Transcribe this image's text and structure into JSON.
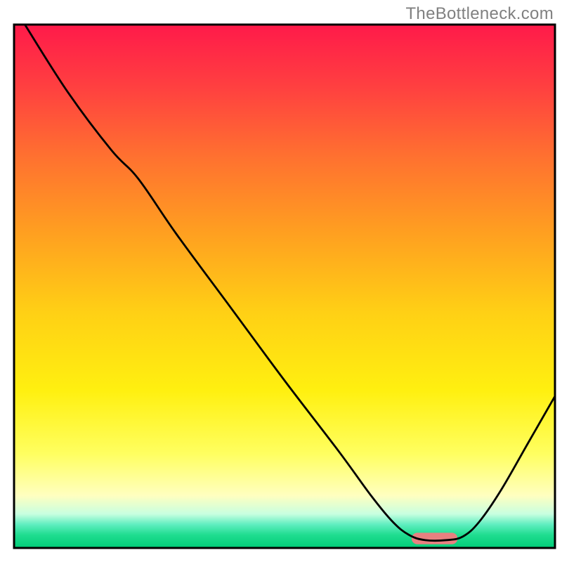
{
  "watermark": "TheBottleneck.com",
  "chart_data": {
    "type": "line",
    "title": "",
    "xlabel": "",
    "ylabel": "",
    "xlim": [
      0,
      100
    ],
    "ylim": [
      0,
      100
    ],
    "background": {
      "type": "vertical-gradient",
      "stops": [
        {
          "offset": 0.0,
          "color": "#ff1a4a"
        },
        {
          "offset": 0.12,
          "color": "#ff4040"
        },
        {
          "offset": 0.25,
          "color": "#ff7030"
        },
        {
          "offset": 0.4,
          "color": "#ffa020"
        },
        {
          "offset": 0.55,
          "color": "#ffd015"
        },
        {
          "offset": 0.7,
          "color": "#fff010"
        },
        {
          "offset": 0.82,
          "color": "#ffff60"
        },
        {
          "offset": 0.9,
          "color": "#ffffc0"
        },
        {
          "offset": 0.935,
          "color": "#c8ffe0"
        },
        {
          "offset": 0.955,
          "color": "#60eec0"
        },
        {
          "offset": 0.975,
          "color": "#20dd90"
        },
        {
          "offset": 1.0,
          "color": "#00cc77"
        }
      ]
    },
    "series": [
      {
        "name": "bottleneck-curve",
        "color": "#000000",
        "width": 2.8,
        "points": [
          {
            "x": 2.0,
            "y": 100.0
          },
          {
            "x": 10.0,
            "y": 87.0
          },
          {
            "x": 18.0,
            "y": 76.0
          },
          {
            "x": 23.0,
            "y": 70.5
          },
          {
            "x": 30.0,
            "y": 60.0
          },
          {
            "x": 40.0,
            "y": 46.0
          },
          {
            "x": 50.0,
            "y": 32.0
          },
          {
            "x": 60.0,
            "y": 18.5
          },
          {
            "x": 66.0,
            "y": 10.0
          },
          {
            "x": 70.0,
            "y": 5.0
          },
          {
            "x": 73.0,
            "y": 2.5
          },
          {
            "x": 76.0,
            "y": 1.5
          },
          {
            "x": 80.0,
            "y": 1.5
          },
          {
            "x": 83.0,
            "y": 2.2
          },
          {
            "x": 86.0,
            "y": 5.0
          },
          {
            "x": 90.0,
            "y": 11.0
          },
          {
            "x": 95.0,
            "y": 20.0
          },
          {
            "x": 100.0,
            "y": 29.0
          }
        ]
      }
    ],
    "marker": {
      "name": "optimal-range-marker",
      "color": "#e88080",
      "x_start": 73.5,
      "x_end": 82.0,
      "y": 1.8,
      "thickness": 2.2
    },
    "frame": {
      "color": "#000000",
      "width": 3
    }
  }
}
